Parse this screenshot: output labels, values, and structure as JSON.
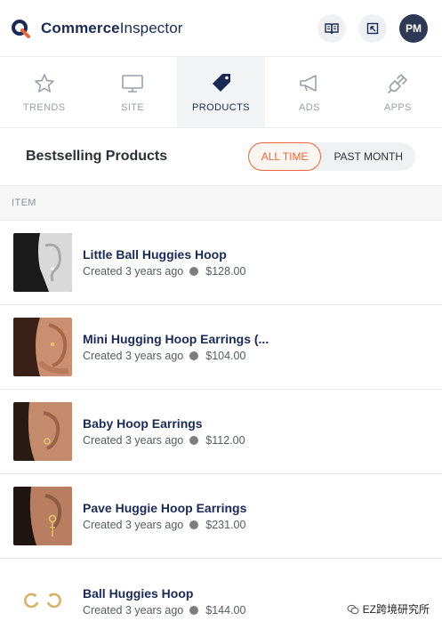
{
  "header": {
    "brand_bold": "Commerce",
    "brand_light": "Inspector",
    "avatar_initials": "PM",
    "icons": [
      "book-icon",
      "open-external-icon"
    ]
  },
  "nav": {
    "tabs": [
      {
        "label": "TRENDS",
        "icon": "star-icon"
      },
      {
        "label": "SITE",
        "icon": "monitor-icon"
      },
      {
        "label": "PRODUCTS",
        "icon": "tag-icon",
        "active": true
      },
      {
        "label": "ADS",
        "icon": "megaphone-icon"
      },
      {
        "label": "APPS",
        "icon": "plug-icon"
      }
    ]
  },
  "section": {
    "title": "Bestselling Products",
    "toggle": {
      "all_time": "ALL TIME",
      "past_month": "PAST MONTH",
      "selected": "ALL TIME"
    }
  },
  "table": {
    "column": "ITEM",
    "rows": [
      {
        "title": "Little Ball Huggies Hoop",
        "created": "Created 3 years ago",
        "price": "$128.00"
      },
      {
        "title": "Mini Hugging Hoop Earrings (...",
        "created": "Created 3 years ago",
        "price": "$104.00"
      },
      {
        "title": "Baby Hoop Earrings",
        "created": "Created 3 years ago",
        "price": "$112.00"
      },
      {
        "title": "Pave Huggie Hoop Earrings",
        "created": "Created 3 years ago",
        "price": "$231.00"
      },
      {
        "title": "Ball Huggies Hoop",
        "created": "Created 3 years ago",
        "price": "$144.00"
      }
    ]
  },
  "watermark": "EZ跨境研究所",
  "colors": {
    "accent": "#e9673b",
    "navy": "#1b2a55",
    "avatar": "#2e3a55"
  }
}
